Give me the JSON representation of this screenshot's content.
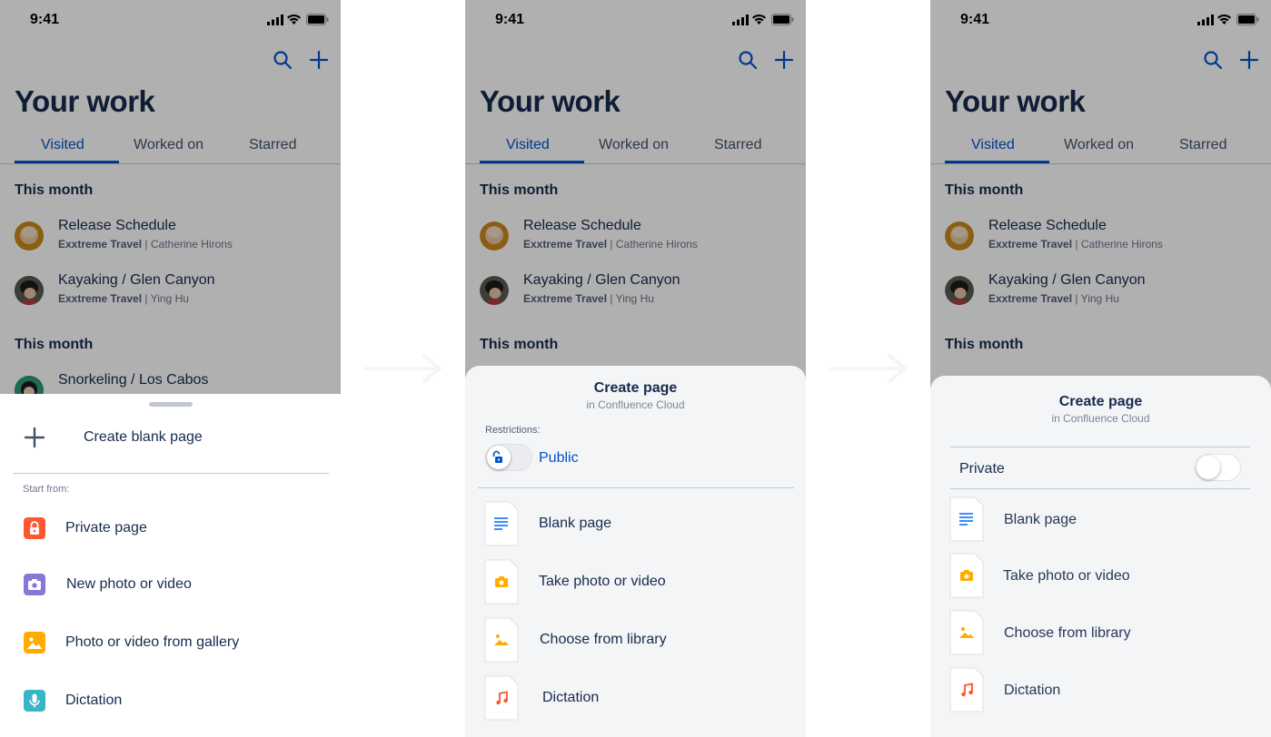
{
  "status_time": "9:41",
  "page_title": "Your work",
  "tabs": [
    "Visited",
    "Worked on",
    "Starred"
  ],
  "section_this_month": "This month",
  "recent": [
    {
      "title": "Release Schedule",
      "space": "Exxtreme Travel",
      "separator": "|",
      "author": "Catherine Hirons",
      "avatar": "avatar-photo"
    },
    {
      "title": "Kayaking / Glen Canyon",
      "space": "Exxtreme Travel",
      "separator": "|",
      "author": "Ying Hu",
      "avatar": "avatar-photo"
    },
    {
      "title": "Snorkeling / Los Cabos",
      "avatar": "avatar-photo"
    }
  ],
  "sheet1": {
    "create_label": "Create blank page",
    "start_from": "Start from:",
    "items": [
      {
        "label": "Private page",
        "icon": "lock-icon",
        "color": "#ff5630"
      },
      {
        "label": "New photo or video",
        "icon": "camera-icon",
        "color": "#8777d9"
      },
      {
        "label": "Photo or video from gallery",
        "icon": "image-icon",
        "color": "#ffab00"
      },
      {
        "label": "Dictation",
        "icon": "microphone-icon",
        "color": "#00b8d9"
      }
    ]
  },
  "sheet2": {
    "title": "Create page",
    "subtitle": "in Confluence Cloud",
    "restrictions_label": "Restrictions:",
    "restriction_value": "Public",
    "items": [
      {
        "label": "Blank page",
        "icon": "text-lines-icon",
        "color": "#0065ff"
      },
      {
        "label": "Take photo or video",
        "icon": "camera-icon",
        "color": "#ffab00"
      },
      {
        "label": "Choose from library",
        "icon": "image-icon",
        "color": "#ffab00"
      },
      {
        "label": "Dictation",
        "icon": "music-note-icon",
        "color": "#ff5630"
      }
    ]
  },
  "sheet3": {
    "title": "Create page",
    "subtitle": "in Confluence Cloud",
    "private_label": "Private",
    "items": [
      {
        "label": "Blank page",
        "icon": "text-lines-icon",
        "color": "#0065ff"
      },
      {
        "label": "Take photo or video",
        "icon": "camera-icon",
        "color": "#ffab00"
      },
      {
        "label": "Choose from library",
        "icon": "image-icon",
        "color": "#ffab00"
      },
      {
        "label": "Dictation",
        "icon": "music-note-icon",
        "color": "#ff5630"
      }
    ]
  },
  "colors": {
    "brand_blue": "#0052cc",
    "ink": "#172b4d",
    "muted": "#6b778c",
    "sheet_gray": "#f4f5f7"
  }
}
